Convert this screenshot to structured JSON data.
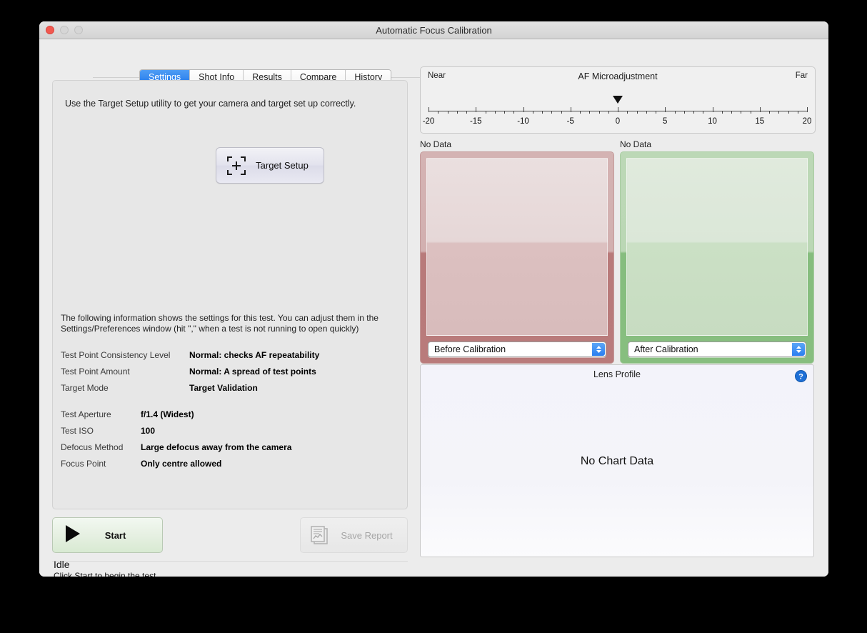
{
  "window": {
    "title": "Automatic Focus Calibration",
    "traffic_lights": [
      "close-button",
      "minimize-button",
      "maximize-button"
    ]
  },
  "tabs": [
    {
      "label": "Settings",
      "active": true
    },
    {
      "label": "Shot Info",
      "active": false
    },
    {
      "label": "Results",
      "active": false
    },
    {
      "label": "Compare",
      "active": false
    },
    {
      "label": "History",
      "active": false
    }
  ],
  "settings_panel": {
    "intro_text": "Use the Target Setup utility to get your camera and target set up correctly.",
    "target_setup_button": "Target Setup",
    "target_setup_icon": "focus-target-icon",
    "description_line1": "The following information shows the settings for this test. You can adjust them in the",
    "description_line2": "Settings/Preferences window (hit \",\" when a test is not running to open quickly)",
    "group_a": [
      {
        "key": "Test Point Consistency Level",
        "value": "Normal: checks AF repeatability"
      },
      {
        "key": "Test Point Amount",
        "value": "Normal: A spread of test points"
      },
      {
        "key": "Target Mode",
        "value": "Target Validation"
      }
    ],
    "group_b": [
      {
        "key": "Test Aperture",
        "value": "f/1.4 (Widest)"
      },
      {
        "key": "Test ISO",
        "value": "100"
      },
      {
        "key": "Defocus Method",
        "value": "Large defocus away from the camera"
      },
      {
        "key": "Focus Point",
        "value": "Only centre allowed"
      }
    ]
  },
  "actions": {
    "start_label": "Start",
    "start_icon": "play-icon",
    "save_report_label": "Save Report",
    "save_report_icon": "chart-document-icon",
    "save_report_enabled": false
  },
  "status": {
    "title": "Idle",
    "subtitle": "Click Start to begin the test"
  },
  "afma": {
    "title": "AF Microadjustment",
    "near_label": "Near",
    "far_label": "Far",
    "min": -20,
    "max": 20,
    "major_step": 5,
    "minor_step": 1,
    "tick_labels": [
      "-20",
      "-15",
      "-10",
      "-5",
      "0",
      "5",
      "10",
      "15",
      "20"
    ],
    "marker_value": 0,
    "marker_icon": "down-triangle-marker"
  },
  "calibration_panels": [
    {
      "caption": "No Data",
      "select_value": "Before Calibration",
      "select_icon": "updown-chevron-icon",
      "accent": "#b87a7a"
    },
    {
      "caption": "No Data",
      "select_value": "After Calibration",
      "select_icon": "updown-chevron-icon",
      "accent": "#86bd7e"
    }
  ],
  "lens_profile": {
    "title": "Lens Profile",
    "help_icon": "help-question-icon",
    "empty_message": "No Chart Data"
  },
  "colors": {
    "tab_active": "#2279ec",
    "before_accent": "#b87a7a",
    "after_accent": "#86bd7e",
    "help_blue": "#1d6fd6",
    "window_bg": "#ececec"
  }
}
